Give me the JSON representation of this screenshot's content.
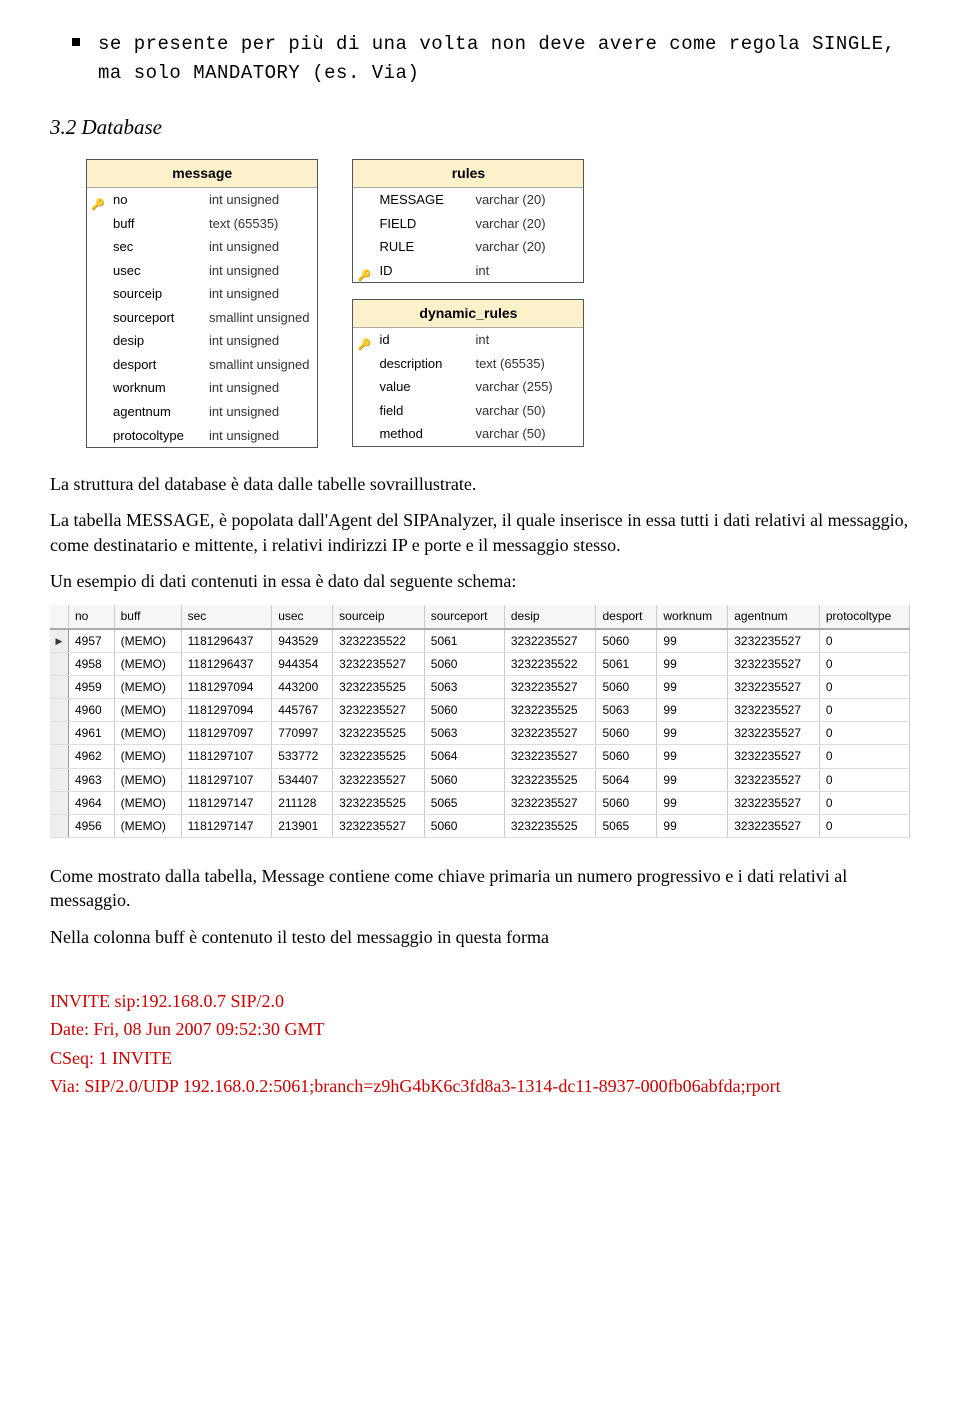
{
  "bullet": "se presente per più di una volta non deve avere come regola SINGLE, ma solo MANDATORY (es. Via)",
  "section_heading": "3.2   Database",
  "schema": {
    "message": {
      "title": "message",
      "rows": [
        {
          "key": true,
          "name": "no",
          "type": "int unsigned"
        },
        {
          "key": false,
          "name": "buff",
          "type": "text (65535)"
        },
        {
          "key": false,
          "name": "sec",
          "type": "int unsigned"
        },
        {
          "key": false,
          "name": "usec",
          "type": "int unsigned"
        },
        {
          "key": false,
          "name": "sourceip",
          "type": "int unsigned"
        },
        {
          "key": false,
          "name": "sourceport",
          "type": "smallint unsigned"
        },
        {
          "key": false,
          "name": "desip",
          "type": "int unsigned"
        },
        {
          "key": false,
          "name": "desport",
          "type": "smallint unsigned"
        },
        {
          "key": false,
          "name": "worknum",
          "type": "int unsigned"
        },
        {
          "key": false,
          "name": "agentnum",
          "type": "int unsigned"
        },
        {
          "key": false,
          "name": "protocoltype",
          "type": "int unsigned"
        }
      ]
    },
    "rules": {
      "title": "rules",
      "rows": [
        {
          "key": false,
          "name": "MESSAGE",
          "type": "varchar (20)"
        },
        {
          "key": false,
          "name": "FIELD",
          "type": "varchar (20)"
        },
        {
          "key": false,
          "name": "RULE",
          "type": "varchar (20)"
        },
        {
          "key": true,
          "name": "ID",
          "type": "int"
        }
      ]
    },
    "dynamic_rules": {
      "title": "dynamic_rules",
      "rows": [
        {
          "key": true,
          "name": "id",
          "type": "int"
        },
        {
          "key": false,
          "name": "description",
          "type": "text (65535)"
        },
        {
          "key": false,
          "name": "value",
          "type": "varchar (255)"
        },
        {
          "key": false,
          "name": "field",
          "type": "varchar (50)"
        },
        {
          "key": false,
          "name": "method",
          "type": "varchar (50)"
        }
      ]
    }
  },
  "para1": "La struttura del database è data dalle tabelle sovraillustrate.",
  "para2": "La tabella MESSAGE, è popolata dall'Agent del SIPAnalyzer, il quale inserisce in essa tutti i dati relativi al messaggio, come destinatario e mittente, i relativi indirizzi IP e porte e il messaggio stesso.",
  "para3": "Un esempio di dati contenuti in essa è dato dal seguente schema:",
  "grid": {
    "headers": [
      "no",
      "buff",
      "sec",
      "usec",
      "sourceip",
      "sourceport",
      "desip",
      "desport",
      "worknum",
      "agentnum",
      "protocoltype"
    ],
    "rows": [
      {
        "cur": true,
        "no": "4957",
        "buff": "(MEMO)",
        "sec": "1181296437",
        "usec": "943529",
        "sourceip": "3232235522",
        "sourceport": "5061",
        "desip": "3232235527",
        "desport": "5060",
        "worknum": "99",
        "agentnum": "3232235527",
        "protocoltype": "0"
      },
      {
        "cur": false,
        "no": "4958",
        "buff": "(MEMO)",
        "sec": "1181296437",
        "usec": "944354",
        "sourceip": "3232235527",
        "sourceport": "5060",
        "desip": "3232235522",
        "desport": "5061",
        "worknum": "99",
        "agentnum": "3232235527",
        "protocoltype": "0"
      },
      {
        "cur": false,
        "no": "4959",
        "buff": "(MEMO)",
        "sec": "1181297094",
        "usec": "443200",
        "sourceip": "3232235525",
        "sourceport": "5063",
        "desip": "3232235527",
        "desport": "5060",
        "worknum": "99",
        "agentnum": "3232235527",
        "protocoltype": "0"
      },
      {
        "cur": false,
        "no": "4960",
        "buff": "(MEMO)",
        "sec": "1181297094",
        "usec": "445767",
        "sourceip": "3232235527",
        "sourceport": "5060",
        "desip": "3232235525",
        "desport": "5063",
        "worknum": "99",
        "agentnum": "3232235527",
        "protocoltype": "0"
      },
      {
        "cur": false,
        "no": "4961",
        "buff": "(MEMO)",
        "sec": "1181297097",
        "usec": "770997",
        "sourceip": "3232235525",
        "sourceport": "5063",
        "desip": "3232235527",
        "desport": "5060",
        "worknum": "99",
        "agentnum": "3232235527",
        "protocoltype": "0"
      },
      {
        "cur": false,
        "no": "4962",
        "buff": "(MEMO)",
        "sec": "1181297107",
        "usec": "533772",
        "sourceip": "3232235525",
        "sourceport": "5064",
        "desip": "3232235527",
        "desport": "5060",
        "worknum": "99",
        "agentnum": "3232235527",
        "protocoltype": "0"
      },
      {
        "cur": false,
        "no": "4963",
        "buff": "(MEMO)",
        "sec": "1181297107",
        "usec": "534407",
        "sourceip": "3232235527",
        "sourceport": "5060",
        "desip": "3232235525",
        "desport": "5064",
        "worknum": "99",
        "agentnum": "3232235527",
        "protocoltype": "0"
      },
      {
        "cur": false,
        "no": "4964",
        "buff": "(MEMO)",
        "sec": "1181297147",
        "usec": "211128",
        "sourceip": "3232235525",
        "sourceport": "5065",
        "desip": "3232235527",
        "desport": "5060",
        "worknum": "99",
        "agentnum": "3232235527",
        "protocoltype": "0"
      },
      {
        "cur": false,
        "no": "4956",
        "buff": "(MEMO)",
        "sec": "1181297147",
        "usec": "213901",
        "sourceip": "3232235527",
        "sourceport": "5060",
        "desip": "3232235525",
        "desport": "5065",
        "worknum": "99",
        "agentnum": "3232235527",
        "protocoltype": "0"
      }
    ]
  },
  "para4": "Come mostrato dalla tabella, Message contiene come chiave primaria un numero progressivo e i dati relativi al messaggio.",
  "para5": "Nella colonna buff è contenuto il testo del messaggio in questa forma",
  "sip": {
    "l1": "INVITE sip:192.168.0.7 SIP/2.0",
    "l2": "Date: Fri, 08 Jun 2007 09:52:30 GMT",
    "l3": "CSeq: 1 INVITE",
    "l4": "Via: SIP/2.0/UDP 192.168.0.2:5061;branch=z9hG4bK6c3fd8a3-1314-dc11-8937-000fb06abfda;rport"
  }
}
